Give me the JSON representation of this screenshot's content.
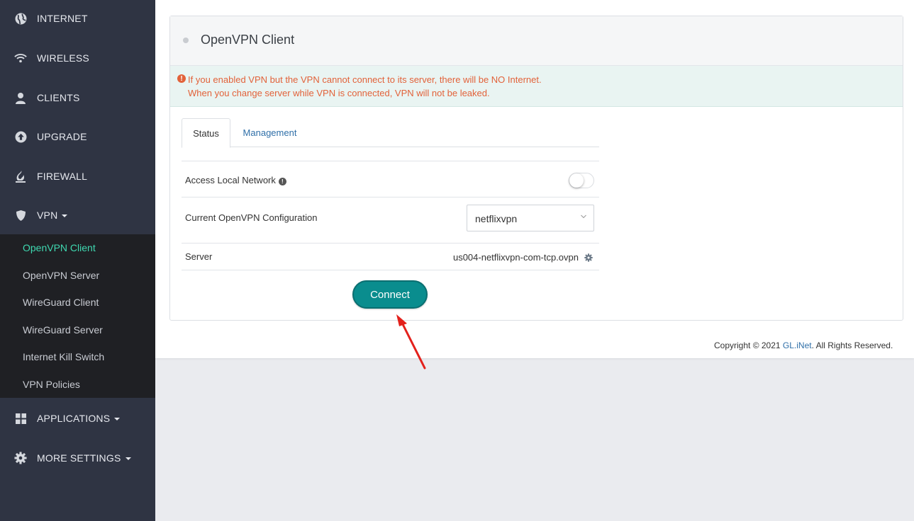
{
  "sidebar": {
    "items": [
      {
        "label": "INTERNET",
        "icon": "globe-icon"
      },
      {
        "label": "WIRELESS",
        "icon": "wifi-icon"
      },
      {
        "label": "CLIENTS",
        "icon": "user-icon"
      },
      {
        "label": "UPGRADE",
        "icon": "upload-icon"
      },
      {
        "label": "FIREWALL",
        "icon": "flame-icon"
      },
      {
        "label": "VPN",
        "icon": "shield-icon"
      },
      {
        "label": "APPLICATIONS",
        "icon": "grid-icon"
      },
      {
        "label": "MORE SETTINGS",
        "icon": "gear-icon"
      }
    ],
    "vpn_submenu": [
      {
        "label": "OpenVPN Client",
        "active": true
      },
      {
        "label": "OpenVPN Server"
      },
      {
        "label": "WireGuard Client"
      },
      {
        "label": "WireGuard Server"
      },
      {
        "label": "Internet Kill Switch"
      },
      {
        "label": "VPN Policies"
      }
    ],
    "active_color": "#3fd9b1"
  },
  "panel": {
    "title": "OpenVPN Client",
    "alert": {
      "line1": "If you enabled VPN but the VPN cannot connect to its server, there will be NO Internet.",
      "line2": "When you change server while VPN is connected, VPN will not be leaked.",
      "color": "#e2623a"
    },
    "tabs": [
      {
        "label": "Status",
        "active": true
      },
      {
        "label": "Management"
      }
    ],
    "rows": {
      "access_local_network": {
        "label": "Access Local Network",
        "enabled": false
      },
      "current_config": {
        "label": "Current OpenVPN Configuration",
        "value": "netflixvpn"
      },
      "server": {
        "label": "Server",
        "value": "us004-netflixvpn-com-tcp.ovpn"
      }
    },
    "connect_label": "Connect",
    "accent": "#0a8d8e"
  },
  "footer": {
    "prefix": "Copyright © 2021 ",
    "link": "GL.iNet",
    "suffix": ". All Rights Reserved."
  }
}
